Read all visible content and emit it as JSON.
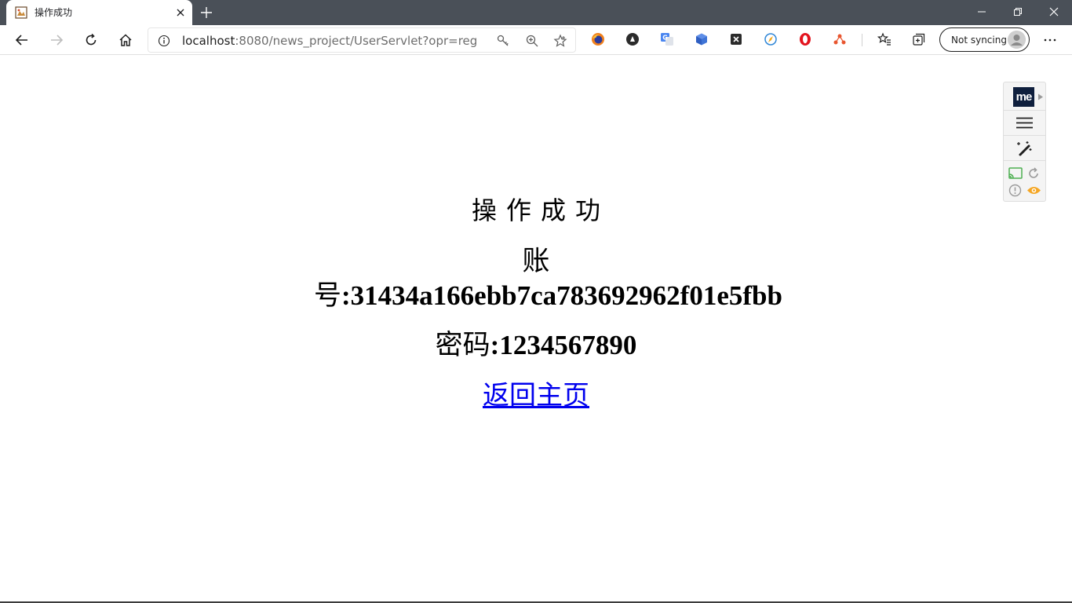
{
  "browser": {
    "tab": {
      "title": "操作成功",
      "favicon": "page-favicon-icon"
    },
    "address_bar": {
      "url_host": "localhost",
      "url_rest": ":8080/news_project/UserServlet?opr=reg"
    },
    "profile": {
      "label": "Not syncing"
    },
    "extensions": [
      "firefox-icon",
      "dark-circle-icon",
      "translate-icon",
      "blue-cube-icon",
      "x-box-icon",
      "compass-icon",
      "opera-red-icon",
      "network-nodes-icon"
    ]
  },
  "page": {
    "title": "操作成功",
    "account_label": "账号:",
    "account_value": "31434a166ebb7ca783692962f01e5fbb",
    "password_label": "密码:",
    "password_value": "1234567890",
    "home_link": "返回主页"
  },
  "side_panel": {
    "logo_text": "me"
  },
  "colors": {
    "titlebar": "#4a5058",
    "link": "#0000ee",
    "text": "#000000"
  }
}
